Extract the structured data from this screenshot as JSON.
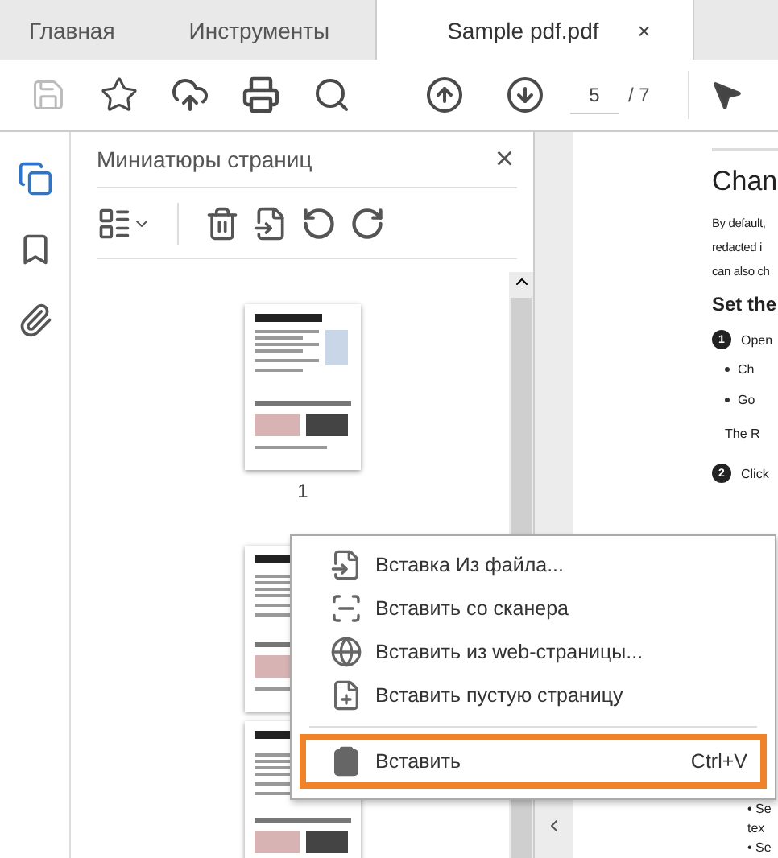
{
  "tabs": [
    {
      "label": "Главная",
      "selected": false
    },
    {
      "label": "Инструменты",
      "selected": false
    },
    {
      "label": "Sample pdf.pdf",
      "selected": true,
      "close": "×"
    }
  ],
  "toolbar": {
    "save_disabled": true,
    "page": "5",
    "page_total": "/ 7"
  },
  "rail": [
    {
      "kind": "pages",
      "selected": true
    },
    {
      "kind": "bookmarks",
      "selected": false
    },
    {
      "kind": "attachments",
      "selected": false
    }
  ],
  "panel": {
    "title": "Миниатюры страниц",
    "close": "×",
    "thumbnails": [
      {
        "kind": "picture",
        "page_label": "1"
      },
      {
        "kind": "picture"
      },
      {
        "kind": "picture"
      }
    ]
  },
  "document": {
    "heading": "Chan",
    "paragraph": [
      "By default,",
      "redacted i",
      "can also ch"
    ],
    "subheading": "Set the",
    "steps": [
      {
        "number": "1",
        "text": "Open",
        "bullets": [
          "Ch",
          "Go"
        ],
        "note": "The R"
      },
      {
        "number": "2",
        "text": "Click"
      }
    ],
    "lower_lines": [
      "• Se",
      "tex",
      "• Se"
    ]
  },
  "context_menu": [
    {
      "kind": "file",
      "label": "Вставка Из файла..."
    },
    {
      "kind": "scanner",
      "label": "Вставить со сканера"
    },
    {
      "kind": "web",
      "label": "Вставить из web-страницы..."
    },
    {
      "kind": "blank",
      "label": "Вставить пустую страницу"
    },
    {
      "kind": "paste",
      "label": "Вставить",
      "shortcut": "Ctrl+V",
      "separator_before": true,
      "highlighted": true
    }
  ]
}
